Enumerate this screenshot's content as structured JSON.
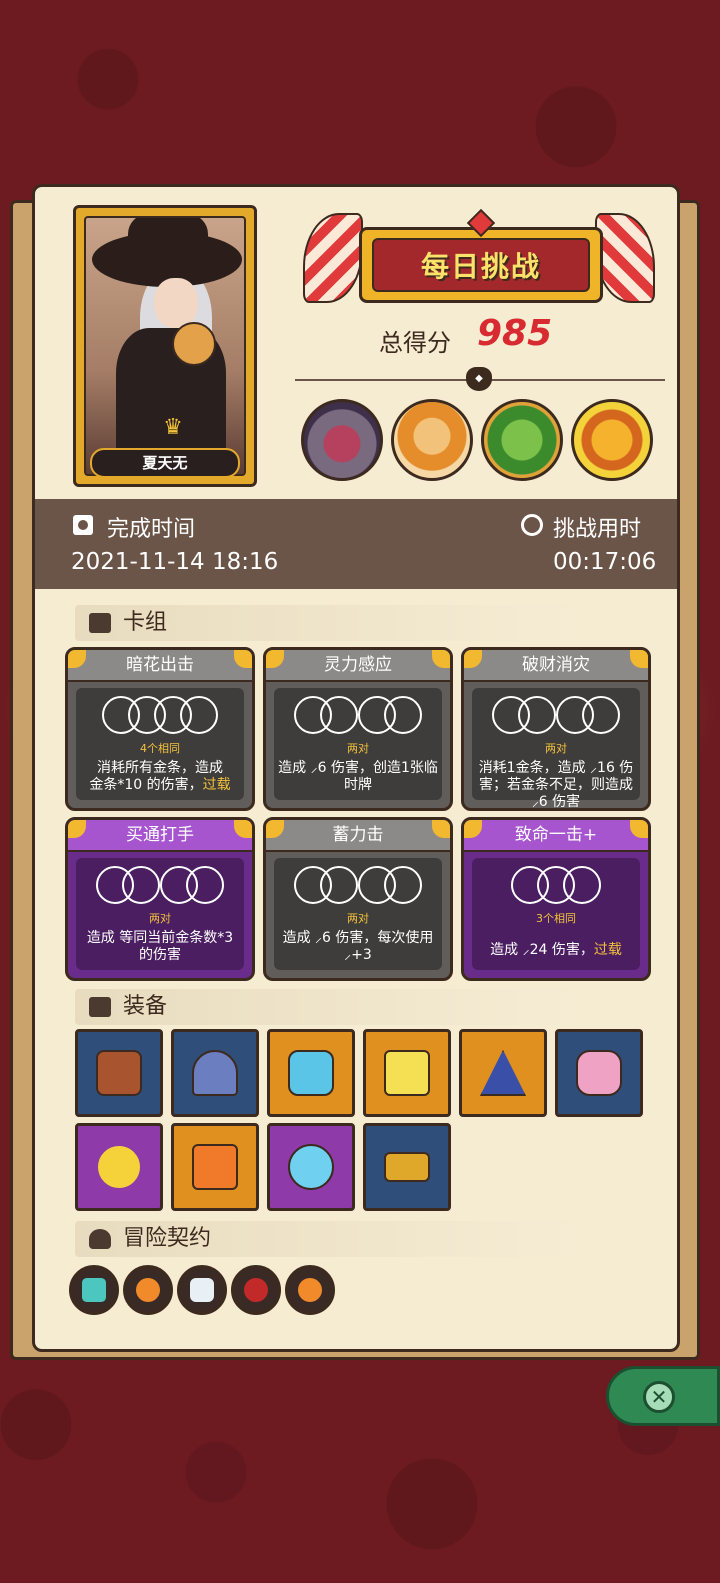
{
  "player": {
    "name": "夏天无"
  },
  "banner": {
    "title": "每日挑战"
  },
  "score": {
    "label": "总得分",
    "value": "985"
  },
  "bosses": [
    {
      "icon": "stone-golem-icon"
    },
    {
      "icon": "pharaoh-boss-icon"
    },
    {
      "icon": "goblin-king-icon"
    },
    {
      "icon": "sun-pumpkin-icon"
    }
  ],
  "info": {
    "finish_label": "完成时间",
    "finish_value": "2021-11-14 18:16",
    "duration_label": "挑战用时",
    "duration_value": "00:17:06"
  },
  "sections": {
    "deck": "卡组",
    "equipment": "装备",
    "contract": "冒险契约"
  },
  "cards": [
    {
      "name": "暗花出击",
      "pattern": "4个相同",
      "desc": "消耗所有",
      "desc2": "金条，造成",
      "desc3": "金条*10 的伤害，",
      "hl": "过载",
      "style": "gray"
    },
    {
      "name": "灵力感应",
      "pattern": "两对",
      "desc": "造成 ⸝6 伤害，创造1张临时牌",
      "style": "gray"
    },
    {
      "name": "破财消灾",
      "pattern": "两对",
      "desc": "消耗1金条，造成 ⸝16 伤害；若金条不足，则造成 ⸝6 伤害",
      "style": "gray"
    },
    {
      "name": "买通打手",
      "pattern": "两对",
      "desc": "造成 等同当前金条数*3 的伤害",
      "style": "purple"
    },
    {
      "name": "蓄力击",
      "pattern": "两对",
      "desc": "造成 ⸝6 伤害，每次使用 ⸝+3",
      "style": "gray"
    },
    {
      "name": "致命一击+",
      "pattern": "3个相同",
      "desc": "造成 ⸝24 伤害，",
      "hl": "过载",
      "style": "purple"
    }
  ],
  "equipment": [
    {
      "icon": "tiki-mask-icon",
      "bg": "blue"
    },
    {
      "icon": "horned-helmet-icon",
      "bg": "blue"
    },
    {
      "icon": "crystal-shield-icon",
      "bg": "orange"
    },
    {
      "icon": "gold-dice-icon",
      "bg": "orange"
    },
    {
      "icon": "triangle-gem-icon",
      "bg": "orange"
    },
    {
      "icon": "pink-gem-icon",
      "bg": "blue"
    },
    {
      "icon": "moon-star-icon",
      "bg": "purple"
    },
    {
      "icon": "orange-dice-icon",
      "bg": "orange"
    },
    {
      "icon": "diamond-ring-icon",
      "bg": "purple"
    },
    {
      "icon": "gold-belt-icon",
      "bg": "blue"
    }
  ],
  "contracts": [
    {
      "icon": "crystal-icon"
    },
    {
      "icon": "fire-burst-icon"
    },
    {
      "icon": "gear-dice-icon"
    },
    {
      "icon": "red-rune-icon"
    },
    {
      "icon": "fire-burst-icon"
    }
  ],
  "colors": {
    "score_red": "#d72a31",
    "panel": "#f6ecd2",
    "accent_gold": "#f1c13a",
    "close_green": "#2e8a52"
  }
}
